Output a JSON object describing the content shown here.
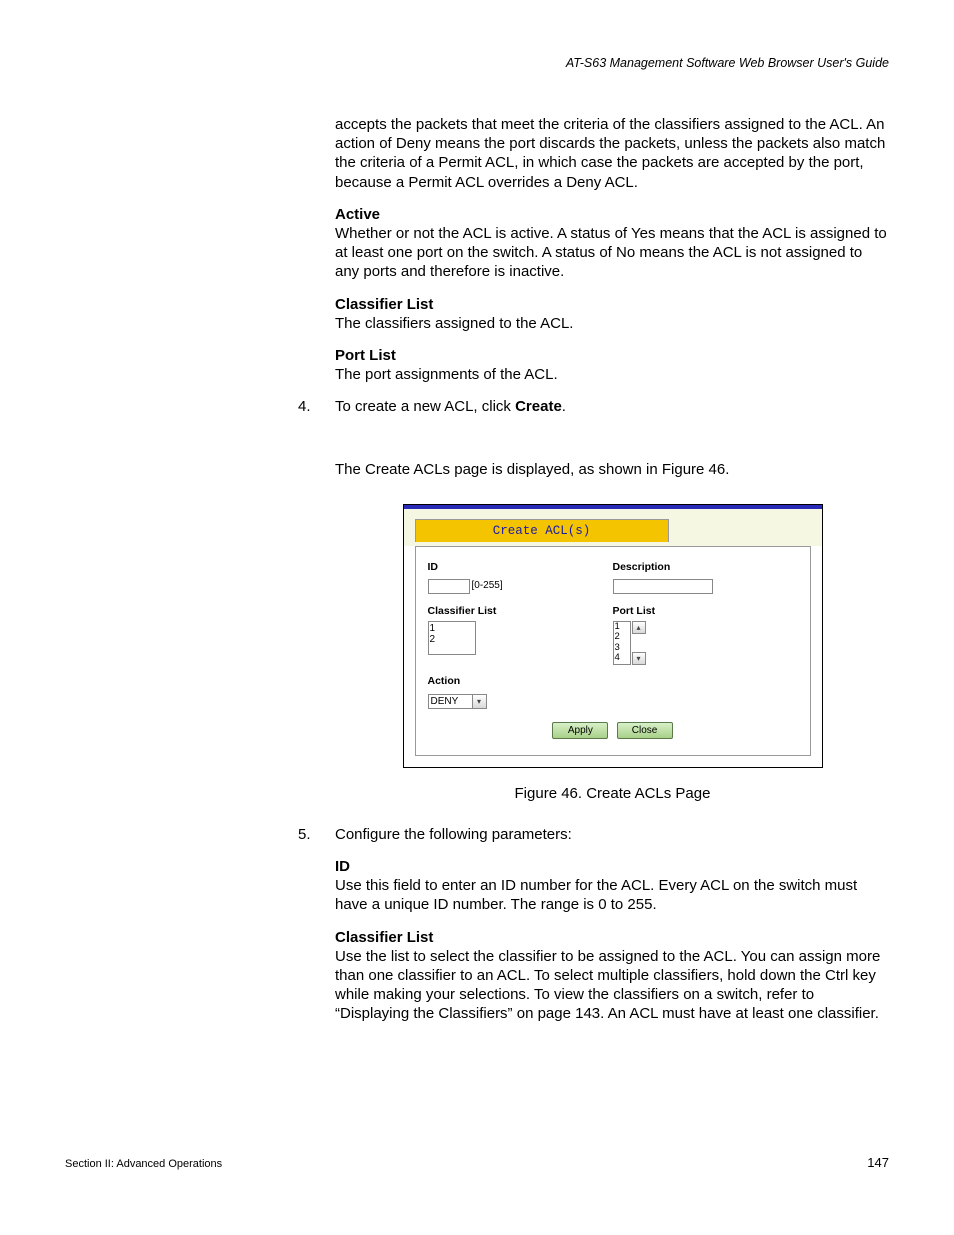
{
  "header": "AT-S63 Management Software Web Browser User's Guide",
  "intro_para": "accepts the packets that meet the criteria of the classifiers assigned to the ACL. An action of Deny means the port discards the packets, unless the packets also match the criteria of a Permit ACL, in which case the packets are accepted by the port, because a Permit ACL overrides a Deny ACL.",
  "active_h": "Active",
  "active_p": "Whether or not the ACL is active. A status of Yes means that the ACL is assigned to at least one port on the switch. A status of No means the ACL is not assigned to any ports and therefore is inactive.",
  "cl_h1": "Classifier List",
  "cl_p1": "The classifiers assigned to the ACL.",
  "pl_h": "Port List",
  "pl_p": "The port assignments of the ACL.",
  "step4_num": "4.",
  "step4_t1": "To create a new ACL, click ",
  "step4_t2": "Create",
  "step4_t3": ".",
  "step4_follow": "The Create ACLs page is displayed, as shown in Figure 46.",
  "fig": {
    "tab": "Create ACL(s)",
    "id_lbl": "ID",
    "id_hint": "[0-255]",
    "desc_lbl": "Description",
    "cl_lbl": "Classifier List",
    "cl_items": [
      "1",
      "2"
    ],
    "port_lbl": "Port List",
    "port_items": [
      "1",
      "2",
      "3",
      "4"
    ],
    "action_lbl": "Action",
    "action_val": "DENY",
    "apply": "Apply",
    "close": "Close"
  },
  "fig_cap": "Figure 46. Create ACLs Page",
  "step5_num": "5.",
  "step5_t": "Configure the following parameters:",
  "id_h": "ID",
  "id_p": "Use this field to enter an ID number for the ACL. Every ACL on the switch must have a unique ID number. The range is 0 to 255.",
  "cl_h2": "Classifier List",
  "cl_p2": "Use the list to select the classifier to be assigned to the ACL. You can assign more than one classifier to an ACL. To select multiple classifiers, hold down the Ctrl key while making your selections. To view the classifiers on a switch, refer to “Displaying the Classifiers” on page 143. An ACL must have at least one classifier.",
  "footer_left": "Section II: Advanced Operations",
  "footer_right": "147"
}
